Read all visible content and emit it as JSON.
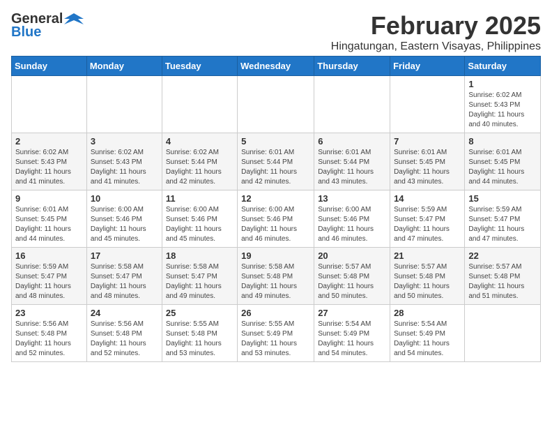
{
  "header": {
    "logo_general": "General",
    "logo_blue": "Blue",
    "title": "February 2025",
    "subtitle": "Hingatungan, Eastern Visayas, Philippines"
  },
  "days_of_week": [
    "Sunday",
    "Monday",
    "Tuesday",
    "Wednesday",
    "Thursday",
    "Friday",
    "Saturday"
  ],
  "weeks": [
    {
      "days": [
        {
          "num": "",
          "info": ""
        },
        {
          "num": "",
          "info": ""
        },
        {
          "num": "",
          "info": ""
        },
        {
          "num": "",
          "info": ""
        },
        {
          "num": "",
          "info": ""
        },
        {
          "num": "",
          "info": ""
        },
        {
          "num": "1",
          "info": "Sunrise: 6:02 AM\nSunset: 5:43 PM\nDaylight: 11 hours and 40 minutes."
        }
      ]
    },
    {
      "days": [
        {
          "num": "2",
          "info": "Sunrise: 6:02 AM\nSunset: 5:43 PM\nDaylight: 11 hours and 41 minutes."
        },
        {
          "num": "3",
          "info": "Sunrise: 6:02 AM\nSunset: 5:43 PM\nDaylight: 11 hours and 41 minutes."
        },
        {
          "num": "4",
          "info": "Sunrise: 6:02 AM\nSunset: 5:44 PM\nDaylight: 11 hours and 42 minutes."
        },
        {
          "num": "5",
          "info": "Sunrise: 6:01 AM\nSunset: 5:44 PM\nDaylight: 11 hours and 42 minutes."
        },
        {
          "num": "6",
          "info": "Sunrise: 6:01 AM\nSunset: 5:44 PM\nDaylight: 11 hours and 43 minutes."
        },
        {
          "num": "7",
          "info": "Sunrise: 6:01 AM\nSunset: 5:45 PM\nDaylight: 11 hours and 43 minutes."
        },
        {
          "num": "8",
          "info": "Sunrise: 6:01 AM\nSunset: 5:45 PM\nDaylight: 11 hours and 44 minutes."
        }
      ]
    },
    {
      "days": [
        {
          "num": "9",
          "info": "Sunrise: 6:01 AM\nSunset: 5:45 PM\nDaylight: 11 hours and 44 minutes."
        },
        {
          "num": "10",
          "info": "Sunrise: 6:00 AM\nSunset: 5:46 PM\nDaylight: 11 hours and 45 minutes."
        },
        {
          "num": "11",
          "info": "Sunrise: 6:00 AM\nSunset: 5:46 PM\nDaylight: 11 hours and 45 minutes."
        },
        {
          "num": "12",
          "info": "Sunrise: 6:00 AM\nSunset: 5:46 PM\nDaylight: 11 hours and 46 minutes."
        },
        {
          "num": "13",
          "info": "Sunrise: 6:00 AM\nSunset: 5:46 PM\nDaylight: 11 hours and 46 minutes."
        },
        {
          "num": "14",
          "info": "Sunrise: 5:59 AM\nSunset: 5:47 PM\nDaylight: 11 hours and 47 minutes."
        },
        {
          "num": "15",
          "info": "Sunrise: 5:59 AM\nSunset: 5:47 PM\nDaylight: 11 hours and 47 minutes."
        }
      ]
    },
    {
      "days": [
        {
          "num": "16",
          "info": "Sunrise: 5:59 AM\nSunset: 5:47 PM\nDaylight: 11 hours and 48 minutes."
        },
        {
          "num": "17",
          "info": "Sunrise: 5:58 AM\nSunset: 5:47 PM\nDaylight: 11 hours and 48 minutes."
        },
        {
          "num": "18",
          "info": "Sunrise: 5:58 AM\nSunset: 5:47 PM\nDaylight: 11 hours and 49 minutes."
        },
        {
          "num": "19",
          "info": "Sunrise: 5:58 AM\nSunset: 5:48 PM\nDaylight: 11 hours and 49 minutes."
        },
        {
          "num": "20",
          "info": "Sunrise: 5:57 AM\nSunset: 5:48 PM\nDaylight: 11 hours and 50 minutes."
        },
        {
          "num": "21",
          "info": "Sunrise: 5:57 AM\nSunset: 5:48 PM\nDaylight: 11 hours and 50 minutes."
        },
        {
          "num": "22",
          "info": "Sunrise: 5:57 AM\nSunset: 5:48 PM\nDaylight: 11 hours and 51 minutes."
        }
      ]
    },
    {
      "days": [
        {
          "num": "23",
          "info": "Sunrise: 5:56 AM\nSunset: 5:48 PM\nDaylight: 11 hours and 52 minutes."
        },
        {
          "num": "24",
          "info": "Sunrise: 5:56 AM\nSunset: 5:48 PM\nDaylight: 11 hours and 52 minutes."
        },
        {
          "num": "25",
          "info": "Sunrise: 5:55 AM\nSunset: 5:48 PM\nDaylight: 11 hours and 53 minutes."
        },
        {
          "num": "26",
          "info": "Sunrise: 5:55 AM\nSunset: 5:49 PM\nDaylight: 11 hours and 53 minutes."
        },
        {
          "num": "27",
          "info": "Sunrise: 5:54 AM\nSunset: 5:49 PM\nDaylight: 11 hours and 54 minutes."
        },
        {
          "num": "28",
          "info": "Sunrise: 5:54 AM\nSunset: 5:49 PM\nDaylight: 11 hours and 54 minutes."
        },
        {
          "num": "",
          "info": ""
        }
      ]
    }
  ]
}
